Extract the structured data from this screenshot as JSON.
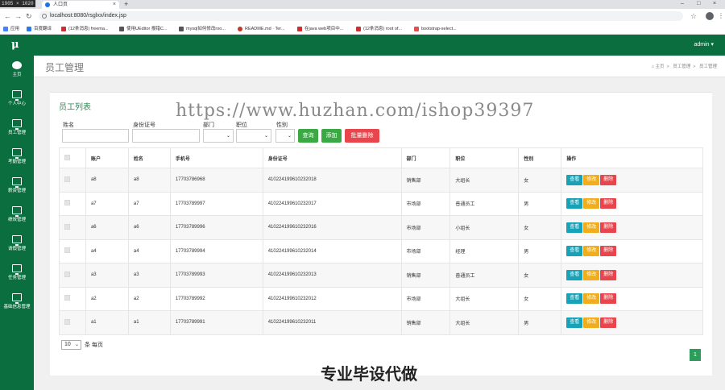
{
  "browser": {
    "os_badge": "1905 × 1020",
    "tab_title": "人口页",
    "url": "localhost:8080/rsglxx/index.jsp",
    "bookmarks": [
      {
        "label": "应用",
        "color": "#4285f4"
      },
      {
        "label": "百度翻译",
        "color": "#2a7ae2"
      },
      {
        "label": "(12条消息) freema...",
        "color": "#c8312f"
      },
      {
        "label": "使用UEditor 报错C...",
        "color": "#555555"
      },
      {
        "label": "mysql如何修改roo...",
        "color": "#555555"
      },
      {
        "label": "README.md · Ter...",
        "color": "#c0392b"
      },
      {
        "label": "在java web项目中...",
        "color": "#c8312f"
      },
      {
        "label": "(12条消息) root of...",
        "color": "#c8312f"
      },
      {
        "label": "bootstrap-select...",
        "color": "#d9534f"
      }
    ]
  },
  "app": {
    "logo": "μ",
    "user": "admin ▾",
    "accent": "#0b6e3f"
  },
  "sidebar": [
    {
      "label": "主页",
      "icon": "dashboard-icon"
    },
    {
      "label": "个人中心",
      "icon": "monitor-icon"
    },
    {
      "label": "员工管理",
      "icon": "monitor-icon"
    },
    {
      "label": "考勤管理",
      "icon": "monitor-icon"
    },
    {
      "label": "薪资管理",
      "icon": "monitor-icon"
    },
    {
      "label": "绩效管理",
      "icon": "monitor-icon"
    },
    {
      "label": "请假管理",
      "icon": "monitor-icon"
    },
    {
      "label": "任务管理",
      "icon": "monitor-icon"
    },
    {
      "label": "基础信息管理",
      "icon": "monitor-icon"
    }
  ],
  "page": {
    "title": "员工管理",
    "breadcrumb": [
      "主页",
      "员工管理",
      "员工管理"
    ]
  },
  "panel": {
    "title": "员工列表",
    "filters": {
      "name_label": "姓名",
      "id_label": "身份证号",
      "dept_label": "部门",
      "position_label": "职位",
      "gender_label": "性别"
    },
    "buttons": {
      "query": "查询",
      "add": "添加",
      "batch_delete": "批量删除"
    }
  },
  "table": {
    "headers": [
      "",
      "账户",
      "姓名",
      "手机号",
      "身份证号",
      "部门",
      "职位",
      "性别",
      "操作"
    ],
    "rows": [
      [
        "a8",
        "a8",
        "17703786968",
        "410224199610232018",
        "销售部",
        "大组长",
        "女"
      ],
      [
        "a7",
        "a7",
        "17703789997",
        "410224199610232017",
        "市场部",
        "普通员工",
        "男"
      ],
      [
        "a6",
        "a6",
        "17703789996",
        "410224199610232016",
        "市场部",
        "小组长",
        "女"
      ],
      [
        "a4",
        "a4",
        "17703789994",
        "410224199610232014",
        "市场部",
        "经理",
        "男"
      ],
      [
        "a3",
        "a3",
        "17703789993",
        "410224199610232013",
        "销售部",
        "普通员工",
        "女"
      ],
      [
        "a2",
        "a2",
        "17703789992",
        "410224199610232012",
        "市场部",
        "大组长",
        "女"
      ],
      [
        "a1",
        "a1",
        "17703789991",
        "410224199610232011",
        "销售部",
        "大组长",
        "男"
      ]
    ],
    "actions": {
      "view": "查看",
      "edit": "修改",
      "delete": "删除"
    }
  },
  "pager": {
    "page_size": "10",
    "suffix": "条 每页",
    "current_page": "1"
  },
  "watermarks": {
    "url": "https://www.huzhan.com/ishop39397",
    "slogan": "专业毕设代做"
  }
}
